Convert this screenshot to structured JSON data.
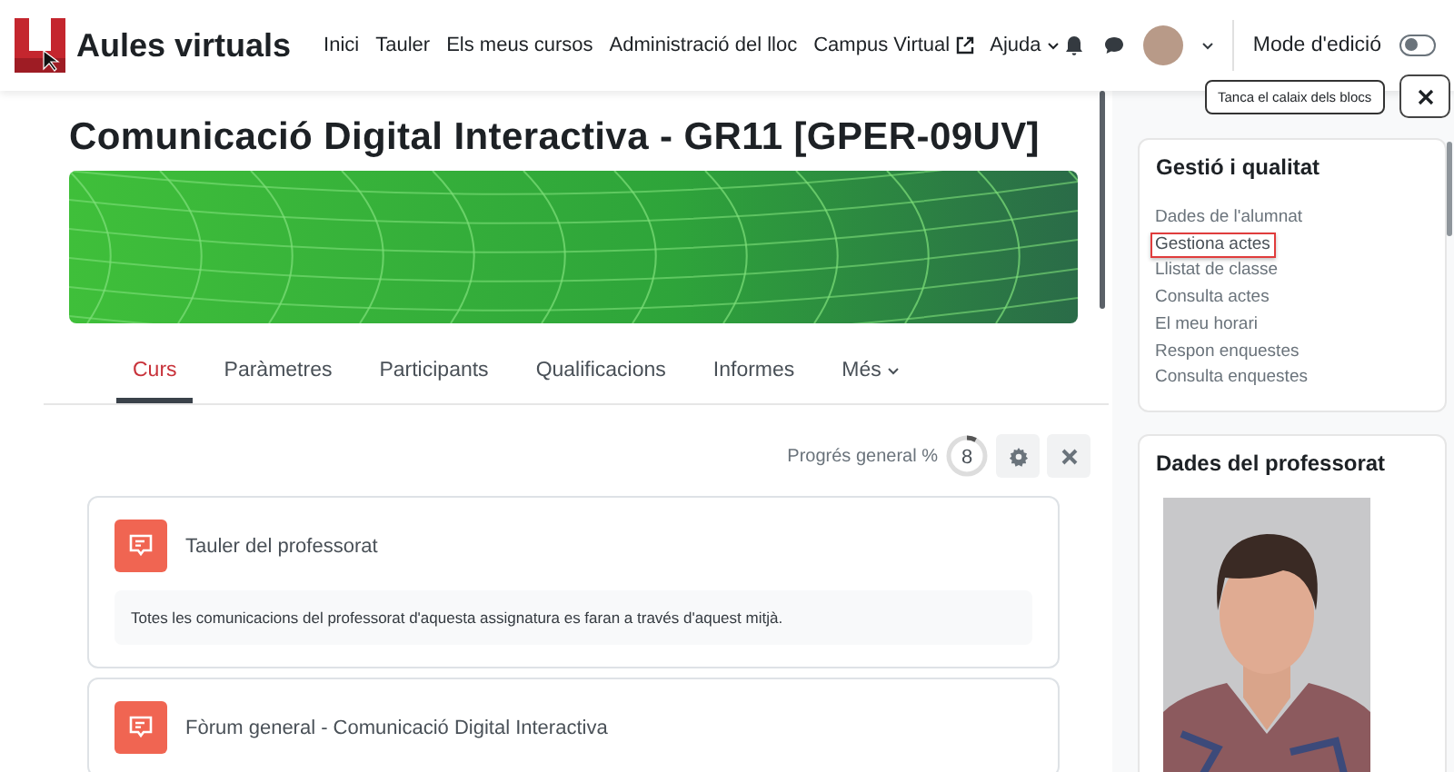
{
  "header": {
    "site_name": "Aules virtuals",
    "nav": [
      {
        "label": "Inici",
        "kind": "link"
      },
      {
        "label": "Tauler",
        "kind": "link"
      },
      {
        "label": "Els meus cursos",
        "kind": "link"
      },
      {
        "label": "Administració del lloc",
        "kind": "link"
      },
      {
        "label": "Campus Virtual",
        "kind": "external"
      },
      {
        "label": "Ajuda",
        "kind": "dropdown"
      }
    ],
    "edit_mode": {
      "label": "Mode d'edició",
      "on": false
    }
  },
  "drawer_tooltip": "Tanca el calaix dels blocs",
  "course": {
    "title": "Comunicació Digital Interactiva - GR11 [GPER-09UV]",
    "tabs": [
      {
        "label": "Curs",
        "selected": true,
        "kind": "link"
      },
      {
        "label": "Paràmetres",
        "selected": false,
        "kind": "link"
      },
      {
        "label": "Participants",
        "selected": false,
        "kind": "link"
      },
      {
        "label": "Qualificacions",
        "selected": false,
        "kind": "link"
      },
      {
        "label": "Informes",
        "selected": false,
        "kind": "link"
      },
      {
        "label": "Més",
        "selected": false,
        "kind": "dropdown"
      }
    ],
    "progress": {
      "label": "Progrés general %",
      "value": "8"
    },
    "activities": [
      {
        "title": "Tauler del professorat",
        "description": "Totes les comunicacions del professorat d'aquesta assignatura es faran a través d'aquest mitjà."
      },
      {
        "title": "Fòrum general - Comunicació Digital Interactiva"
      }
    ]
  },
  "blocks": [
    {
      "title": "Gestió i qualitat",
      "kind": "links",
      "links": [
        {
          "label": "Dades de l'alumnat",
          "highlighted": false
        },
        {
          "label": "Gestiona actes",
          "highlighted": true
        },
        {
          "label": "Llistat de classe",
          "highlighted": false
        },
        {
          "label": "Consulta actes",
          "highlighted": false
        },
        {
          "label": "El meu horari",
          "highlighted": false
        },
        {
          "label": "Respon enquestes",
          "highlighted": false
        },
        {
          "label": "Consulta enquestes",
          "highlighted": false
        }
      ]
    },
    {
      "title": "Dades del professorat",
      "kind": "picture"
    }
  ]
}
